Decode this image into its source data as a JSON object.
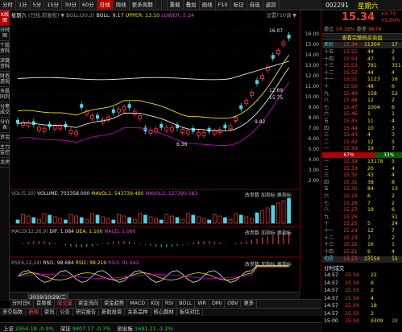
{
  "topbar": {
    "tabs": [
      "分时",
      "1分",
      "5分",
      "15分",
      "30分",
      "60分",
      "日线",
      "周线",
      "更多周期",
      "",
      "",
      "重载",
      "叠加",
      "画线",
      "F10",
      "标记",
      "自选",
      "返回"
    ],
    "active_index": 6
  },
  "leftnav": {
    "items": [
      "K线图",
      "分时图",
      "个股资料",
      "深度资料",
      "财务透视",
      "多股同列",
      "分笔成交",
      "分价表",
      "资金",
      "主力监控",
      "龙虎"
    ],
    "active_index": 0
  },
  "chart": {
    "stock_name": "星期六",
    "indicator_line": "(日线,前复权) ▼",
    "boll_params": "BOLL(20,2)",
    "boll_label": "BOLL: 9.17",
    "upper_label": "UPPER: 13.10",
    "lower_label": "LOWER: 5.24",
    "settings": "设置F10调 ▼",
    "peak_label": "16.07",
    "label_1": "12.69",
    "label_2": "15.75",
    "label_3": "9.82",
    "label_4": "6.36",
    "vol_title": "VOL(5,10)",
    "vol_value": "VOLUME: 703358.000",
    "mavol1": "MAVOL1: 543739.400",
    "mavol2": "MAVOL2: 127390.083",
    "macd_title": "MACD(12,26,9)",
    "macd_dif": "DIF: 1.084",
    "macd_dea": "DEA: 1.100",
    "macd_val": "MACD: 1.060",
    "rsi_title": "RSI(6,12,24)",
    "rsi1": "RSI1: 98.684",
    "rsi2": "RSI2: 98.219",
    "rsi3": "RSI3: 91.642",
    "panel_buttons": [
      "改参数",
      "加指标",
      "换指标"
    ],
    "date": "2019/10/29/二"
  },
  "price_axis": [
    "16.00",
    "15.00",
    "14.00",
    "13.00",
    "12.00",
    "11.00",
    "10.00",
    "9.00",
    "8.00",
    "7.00",
    "6.00",
    "5.00",
    "4.00",
    "3.00",
    "2.00"
  ],
  "quote": {
    "code": "002291",
    "name": "星期六",
    "price": "15.34",
    "change": "+0.73",
    "change_pct": "+5.00%",
    "wei_bi_label": "委比",
    "wei_bi": "34.39%",
    "wei_cha_label": "委差",
    "wei_cha": "9674",
    "orderbook_title": "查看完整档买卖盘",
    "sell_head": "卖价",
    "sell_price": "15.34",
    "sell_vol": "11304",
    "sell_count": "17",
    "sells": [
      [
        "十五",
        "15.55",
        "44",
        "2"
      ],
      [
        "十四",
        "15.54",
        "47",
        "3"
      ],
      [
        "十三",
        "15.53",
        "781",
        "351"
      ],
      [
        "十二",
        "15.52",
        "44",
        "4"
      ],
      [
        "十一",
        "15.51",
        "1123",
        "16"
      ],
      [
        "十",
        "15.50",
        "48",
        "6"
      ],
      [
        "九",
        "15.49",
        "158",
        "52"
      ],
      [
        "八",
        "15.48",
        "12",
        "2"
      ],
      [
        "七",
        "15.47",
        "1004",
        "6"
      ],
      [
        "六",
        "15.46",
        "1",
        "1"
      ],
      [
        "五",
        "15.45",
        "11",
        "4"
      ],
      [
        "四",
        "15.44",
        "10",
        "3"
      ],
      [
        "三",
        "15.43",
        "4",
        "3"
      ],
      [
        "二",
        "15.42",
        "12",
        "5"
      ],
      [
        "一",
        "15.39",
        "19",
        "7"
      ]
    ],
    "ratio_left": "67%",
    "ratio_right": "33%",
    "buys": [
      [
        "一",
        "15.34",
        "13178",
        "5"
      ],
      [
        "二",
        "15.33",
        "20",
        "4"
      ],
      [
        "三",
        "15.32",
        "43",
        "4"
      ],
      [
        "四",
        "15.31",
        "38",
        "8"
      ],
      [
        "五",
        "15.30",
        "84",
        "13"
      ],
      [
        "六",
        "15.29",
        "6",
        "2"
      ],
      [
        "七",
        "15.28",
        "7",
        "2"
      ],
      [
        "八",
        "15.27",
        "19",
        "6"
      ],
      [
        "九",
        "15.26",
        "",
        "51"
      ],
      [
        "十",
        "15.25",
        "5",
        "24"
      ],
      [
        "十一",
        "15.24",
        "12",
        "7"
      ],
      [
        "十二",
        "15.23",
        "7",
        "2"
      ],
      [
        "十三",
        "15.22",
        "16",
        "1"
      ],
      [
        "十四",
        "15.21",
        "6",
        "4"
      ],
      [
        "十五",
        "15.20",
        "22",
        "3"
      ]
    ],
    "buy_head": "买价",
    "bottom_row1": "均价",
    "bottom_val1": "14.23",
    "bottom_vol1": "23156",
    "bottom_count1": "15",
    "ticks_title": "分时成交",
    "ticks": [
      [
        "14:57",
        "15.34",
        "22"
      ],
      [
        "14:57",
        "15.34",
        "6"
      ],
      [
        "14:57",
        "15.33",
        "2"
      ],
      [
        "14:57",
        "15.34",
        "4"
      ],
      [
        "14:57",
        "15.34",
        "18"
      ],
      [
        "14:57",
        "15.33",
        "2"
      ],
      [
        "15:00",
        "15.34",
        "9309",
        "28"
      ]
    ]
  },
  "bottom_tabs1": [
    "分时日K",
    "首要模",
    "成交量",
    "资金流向",
    "资金趋势",
    "MACD",
    "KDJ",
    "RSI",
    "BOLL",
    "WR",
    "DMI",
    "OBV",
    "更多"
  ],
  "bottom_tabs1_active": 2,
  "bottom_tabs2": [
    "多空指数",
    "新闻",
    "资讯",
    "公告",
    "研究报告",
    "新股投资",
    "关系品种",
    "核心题材",
    "板块对比"
  ],
  "bottom_tabs2_active": 1,
  "ticker": [
    {
      "name": "上证",
      "value": "2954.18",
      "chg": "-0.9%"
    },
    {
      "name": "深证",
      "value": "9807.17",
      "chg": "-0.7%"
    },
    {
      "name": "创业板",
      "value": "1691.21",
      "chg": "-1.2%"
    }
  ],
  "colors": {
    "up": "#ff3a3a",
    "down": "#2ed12e",
    "boll_mid": "#e6e6e6",
    "upper": "#f0e000",
    "lower": "#c000c0",
    "accent": "#b00000"
  }
}
